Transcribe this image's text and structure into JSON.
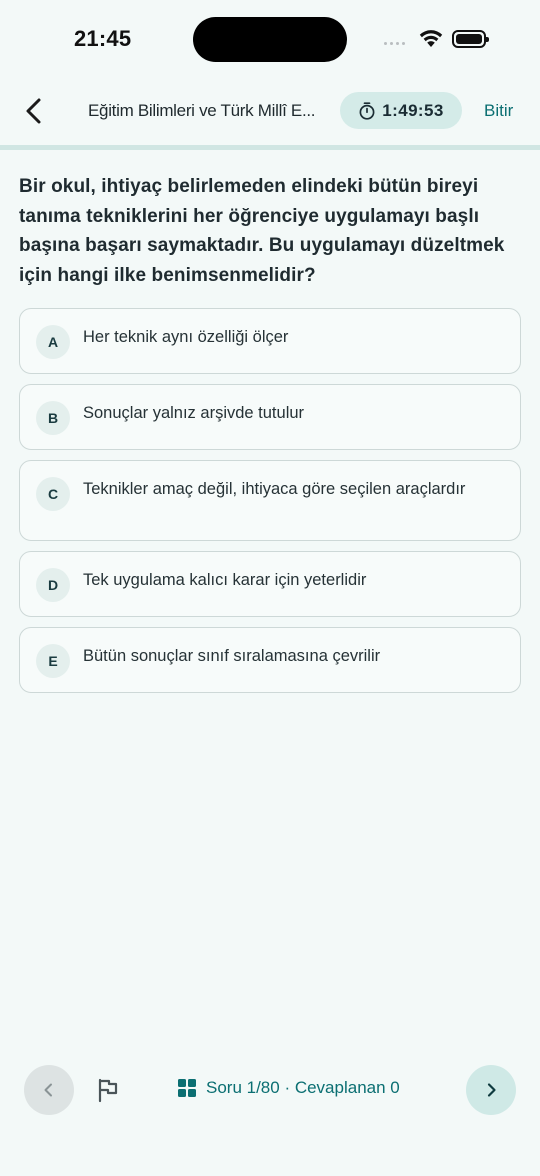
{
  "status_bar": {
    "time": "21:45"
  },
  "header": {
    "title": "Eğitim Bilimleri ve Türk Millî E...",
    "timer": "1:49:53",
    "finish_label": "Bitir"
  },
  "question": {
    "text": "Bir okul, ihtiyaç belirlemeden elindeki bütün bireyi tanıma tekniklerini her öğrenciye uygulamayı başlı başına başarı saymaktadır. Bu uygulamayı düzeltmek için hangi ilke benimsenmelidir?"
  },
  "options": [
    {
      "letter": "A",
      "text": "Her teknik aynı özelliği ölçer"
    },
    {
      "letter": "B",
      "text": "Sonuçlar yalnız arşivde tutulur"
    },
    {
      "letter": "C",
      "text": "Teknikler amaç değil, ihtiyaca göre seçilen araçlardır"
    },
    {
      "letter": "D",
      "text": "Tek uygulama kalıcı karar için yeterlidir"
    },
    {
      "letter": "E",
      "text": "Bütün sonuçlar sınıf sıralamasına çevrilir"
    }
  ],
  "bottom_nav": {
    "counter": "Soru 1/80 · Cevaplanan 0"
  },
  "colors": {
    "accent": "#0b6f72",
    "background": "#f3f9f8",
    "timer_bg": "#d4ebe8"
  },
  "icons": {
    "back": "chevron-left-icon",
    "timer": "stopwatch-icon",
    "flag": "flag-icon",
    "grid": "grid-icon",
    "prev": "chevron-left-icon",
    "next": "chevron-right-icon"
  }
}
